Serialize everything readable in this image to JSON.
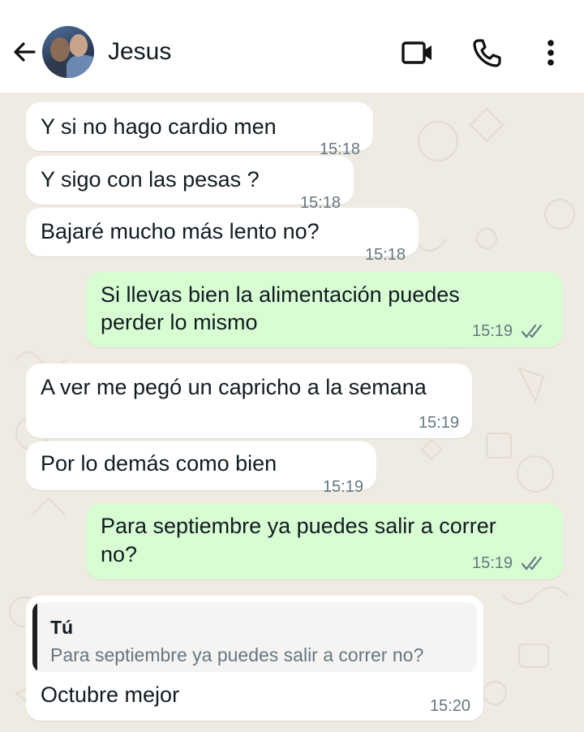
{
  "header": {
    "contact_name": "Jesus",
    "icons": [
      "back-arrow-icon",
      "video-call-icon",
      "voice-call-icon",
      "more-options-icon"
    ]
  },
  "messages": [
    {
      "dir": "in",
      "text": "Y si no hago cardio men",
      "time": "15:18"
    },
    {
      "dir": "in",
      "text": "Y sigo con las pesas ?",
      "time": "15:18"
    },
    {
      "dir": "in",
      "text": "Bajaré mucho más lento no?",
      "time": "15:18"
    },
    {
      "dir": "out",
      "text_line1": "Si llevas bien la alimentación puedes",
      "text_line2": "perder lo mismo",
      "time": "15:19",
      "status": "read"
    },
    {
      "dir": "in",
      "text": "A ver me pegó un capricho a la semana",
      "time": "15:19"
    },
    {
      "dir": "in",
      "text": "Por lo demás como bien",
      "time": "15:19"
    },
    {
      "dir": "out",
      "text_line1": "Para septiembre ya puedes salir a correr",
      "text_line2": "no?",
      "time": "15:19",
      "status": "read"
    },
    {
      "dir": "in",
      "reply_to": {
        "author": "Tú",
        "text": "Para septiembre ya puedes salir a correr no?"
      },
      "text": "Octubre mejor",
      "time": "15:20"
    }
  ],
  "colors": {
    "incoming_bubble": "#ffffff",
    "outgoing_bubble": "#d9fdd3",
    "chat_background": "#efeae2",
    "read_ticks": "#667781"
  }
}
